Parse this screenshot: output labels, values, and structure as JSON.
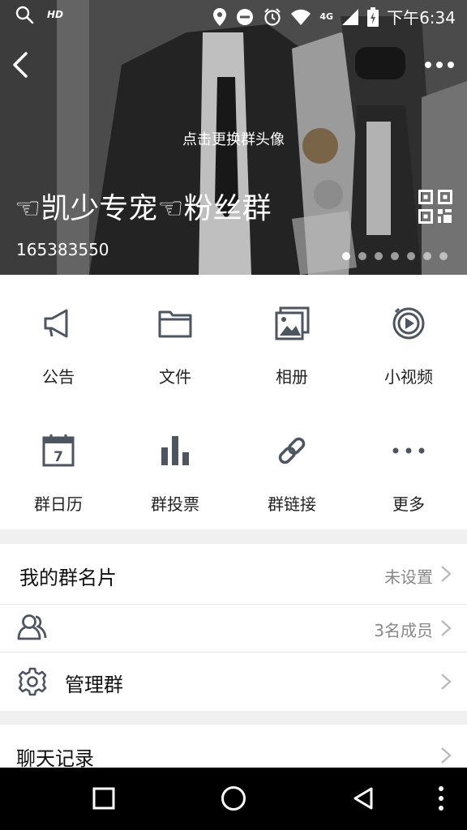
{
  "status_bar": {
    "hd_label": "HD",
    "network_label": "4G",
    "time": "下午6:34",
    "icons": [
      "search-icon",
      "location-icon",
      "do-not-disturb-icon",
      "alarm-icon",
      "wifi-icon",
      "signal-icon",
      "battery-charging-icon"
    ]
  },
  "header": {
    "change_avatar_text": "点击更换群头像",
    "group_name": "☜凯少专宠☜粉丝群",
    "group_id": "165383550",
    "page_indicator": {
      "count": 7,
      "active": 0
    }
  },
  "functions": [
    {
      "label": "公告",
      "icon": "announcement-icon"
    },
    {
      "label": "文件",
      "icon": "folder-icon"
    },
    {
      "label": "相册",
      "icon": "album-icon"
    },
    {
      "label": "小视频",
      "icon": "video-icon"
    },
    {
      "label": "群日历",
      "icon": "calendar-icon"
    },
    {
      "label": "群投票",
      "icon": "vote-icon"
    },
    {
      "label": "群链接",
      "icon": "link-icon"
    },
    {
      "label": "更多",
      "icon": "more-icon"
    }
  ],
  "calendar_icon_day": "7",
  "list": {
    "card_label": "我的群名片",
    "card_value": "未设置",
    "members_value": "3名成员",
    "manage_label": "管理群",
    "history_label": "聊天记录"
  },
  "colors": {
    "icon": "#4d5560",
    "chevron": "#bbbbbb",
    "value_text": "#888888"
  }
}
